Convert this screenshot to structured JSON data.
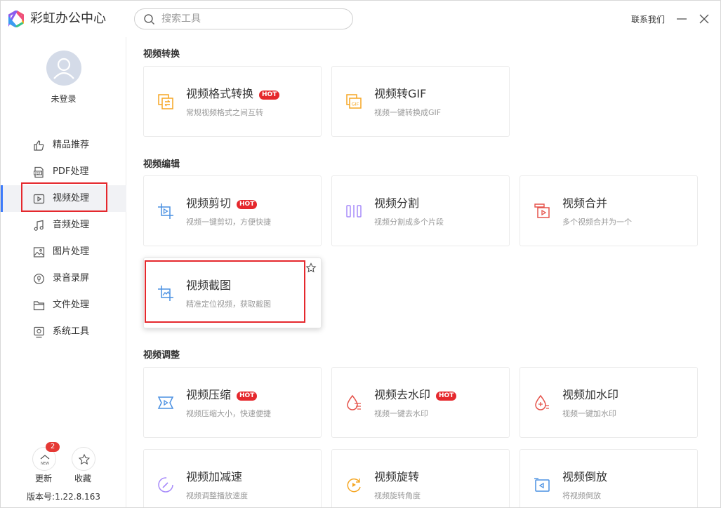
{
  "app": {
    "title": "彩虹办公中心"
  },
  "search": {
    "placeholder": "搜索工具"
  },
  "header": {
    "contact": "联系我们"
  },
  "user": {
    "login_status": "未登录"
  },
  "sidebar": {
    "items": [
      {
        "label": "精品推荐",
        "icon": "thumb-up-icon"
      },
      {
        "label": "PDF处理",
        "icon": "pdf-icon"
      },
      {
        "label": "视频处理",
        "icon": "video-icon"
      },
      {
        "label": "音频处理",
        "icon": "music-icon"
      },
      {
        "label": "图片处理",
        "icon": "image-icon"
      },
      {
        "label": "录音录屏",
        "icon": "record-icon"
      },
      {
        "label": "文件处理",
        "icon": "folder-icon"
      },
      {
        "label": "系统工具",
        "icon": "system-icon"
      }
    ],
    "active_index": 2,
    "update": {
      "label": "更新",
      "badge": "2",
      "icon_text": "NEW"
    },
    "favorites": {
      "label": "收藏"
    },
    "version": "版本号:1.22.8.163"
  },
  "sections": [
    {
      "title": "视频转换",
      "cards": [
        {
          "title": "视频格式转换",
          "hot": "HOT",
          "desc": "常规视频格式之间互转",
          "icon": "video-format-convert-icon"
        },
        {
          "title": "视频转GIF",
          "hot": "",
          "desc": "视频一键转换成GIF",
          "icon": "video-to-gif-icon"
        }
      ]
    },
    {
      "title": "视频编辑",
      "cards": [
        {
          "title": "视频剪切",
          "hot": "HOT",
          "desc": "视频一键剪切，方便快捷",
          "icon": "video-cut-icon"
        },
        {
          "title": "视频分割",
          "hot": "",
          "desc": "视频分割成多个片段",
          "icon": "video-split-icon"
        },
        {
          "title": "视频合并",
          "hot": "",
          "desc": "多个视频合并为一个",
          "icon": "video-merge-icon"
        },
        {
          "title": "视频截图",
          "hot": "",
          "desc": "精准定位视频，获取截图",
          "icon": "video-screenshot-icon"
        }
      ]
    },
    {
      "title": "视频调整",
      "cards": [
        {
          "title": "视频压缩",
          "hot": "HOT",
          "desc": "视频压缩大小，快速便捷",
          "icon": "video-compress-icon"
        },
        {
          "title": "视频去水印",
          "hot": "HOT",
          "desc": "视频一键去水印",
          "icon": "remove-watermark-icon"
        },
        {
          "title": "视频加水印",
          "hot": "",
          "desc": "视频一键加水印",
          "icon": "add-watermark-icon"
        },
        {
          "title": "视频加减速",
          "hot": "",
          "desc": "视频调整播放速度",
          "icon": "speed-icon"
        },
        {
          "title": "视频旋转",
          "hot": "",
          "desc": "视频旋转角度",
          "icon": "rotate-icon"
        },
        {
          "title": "视频倒放",
          "hot": "",
          "desc": "将视频倒放",
          "icon": "reverse-icon"
        }
      ]
    }
  ],
  "colors": {
    "accent": "#3d7bfa",
    "hot": "#e5282d",
    "highlight": "#e5282d"
  }
}
